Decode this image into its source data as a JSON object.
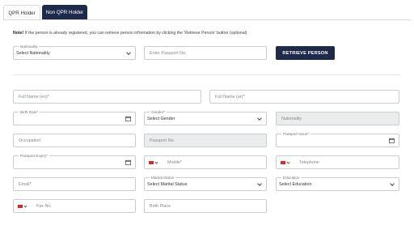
{
  "tabs": [
    {
      "label": "QPR Holder",
      "active": false
    },
    {
      "label": "Non QPR Holder",
      "active": true
    }
  ],
  "note": {
    "bold": "Note!",
    "text": " If the person is already registered, you can retrieve person information by clicking the 'Retrieve Person' button (optional)"
  },
  "search": {
    "nationality_label": "Nationality",
    "nationality_value": "Select Nationality",
    "passport_placeholder": "Enter Passport No.",
    "retrieve_button": "RETRIEVE PERSON"
  },
  "form": {
    "full_name_en": "Full Name (en)*",
    "full_name_ar": "Full Name (ar)*",
    "birth_date_label": "Birth Date*",
    "gender_label": "Gender*",
    "gender_value": "Select Gender",
    "nationality": "Nationality",
    "occupation": "Occupation",
    "passport_no": "Passport No.",
    "passport_issue_label": "Passport Issue*",
    "passport_expiry_label": "Passport Expiry*",
    "mobile": "Mobile*",
    "telephone": "Telephone",
    "email": "Email*",
    "marital_label": "Marital Status",
    "marital_value": "Select Marital Status",
    "education_label": "Education",
    "education_value": "Select Education",
    "fax": "Fax No.",
    "birth_place": "Birth Place"
  },
  "colors": {
    "primary": "#1e2a4a",
    "flag": "#d42a2a",
    "disabled_bg": "#ebeced"
  }
}
